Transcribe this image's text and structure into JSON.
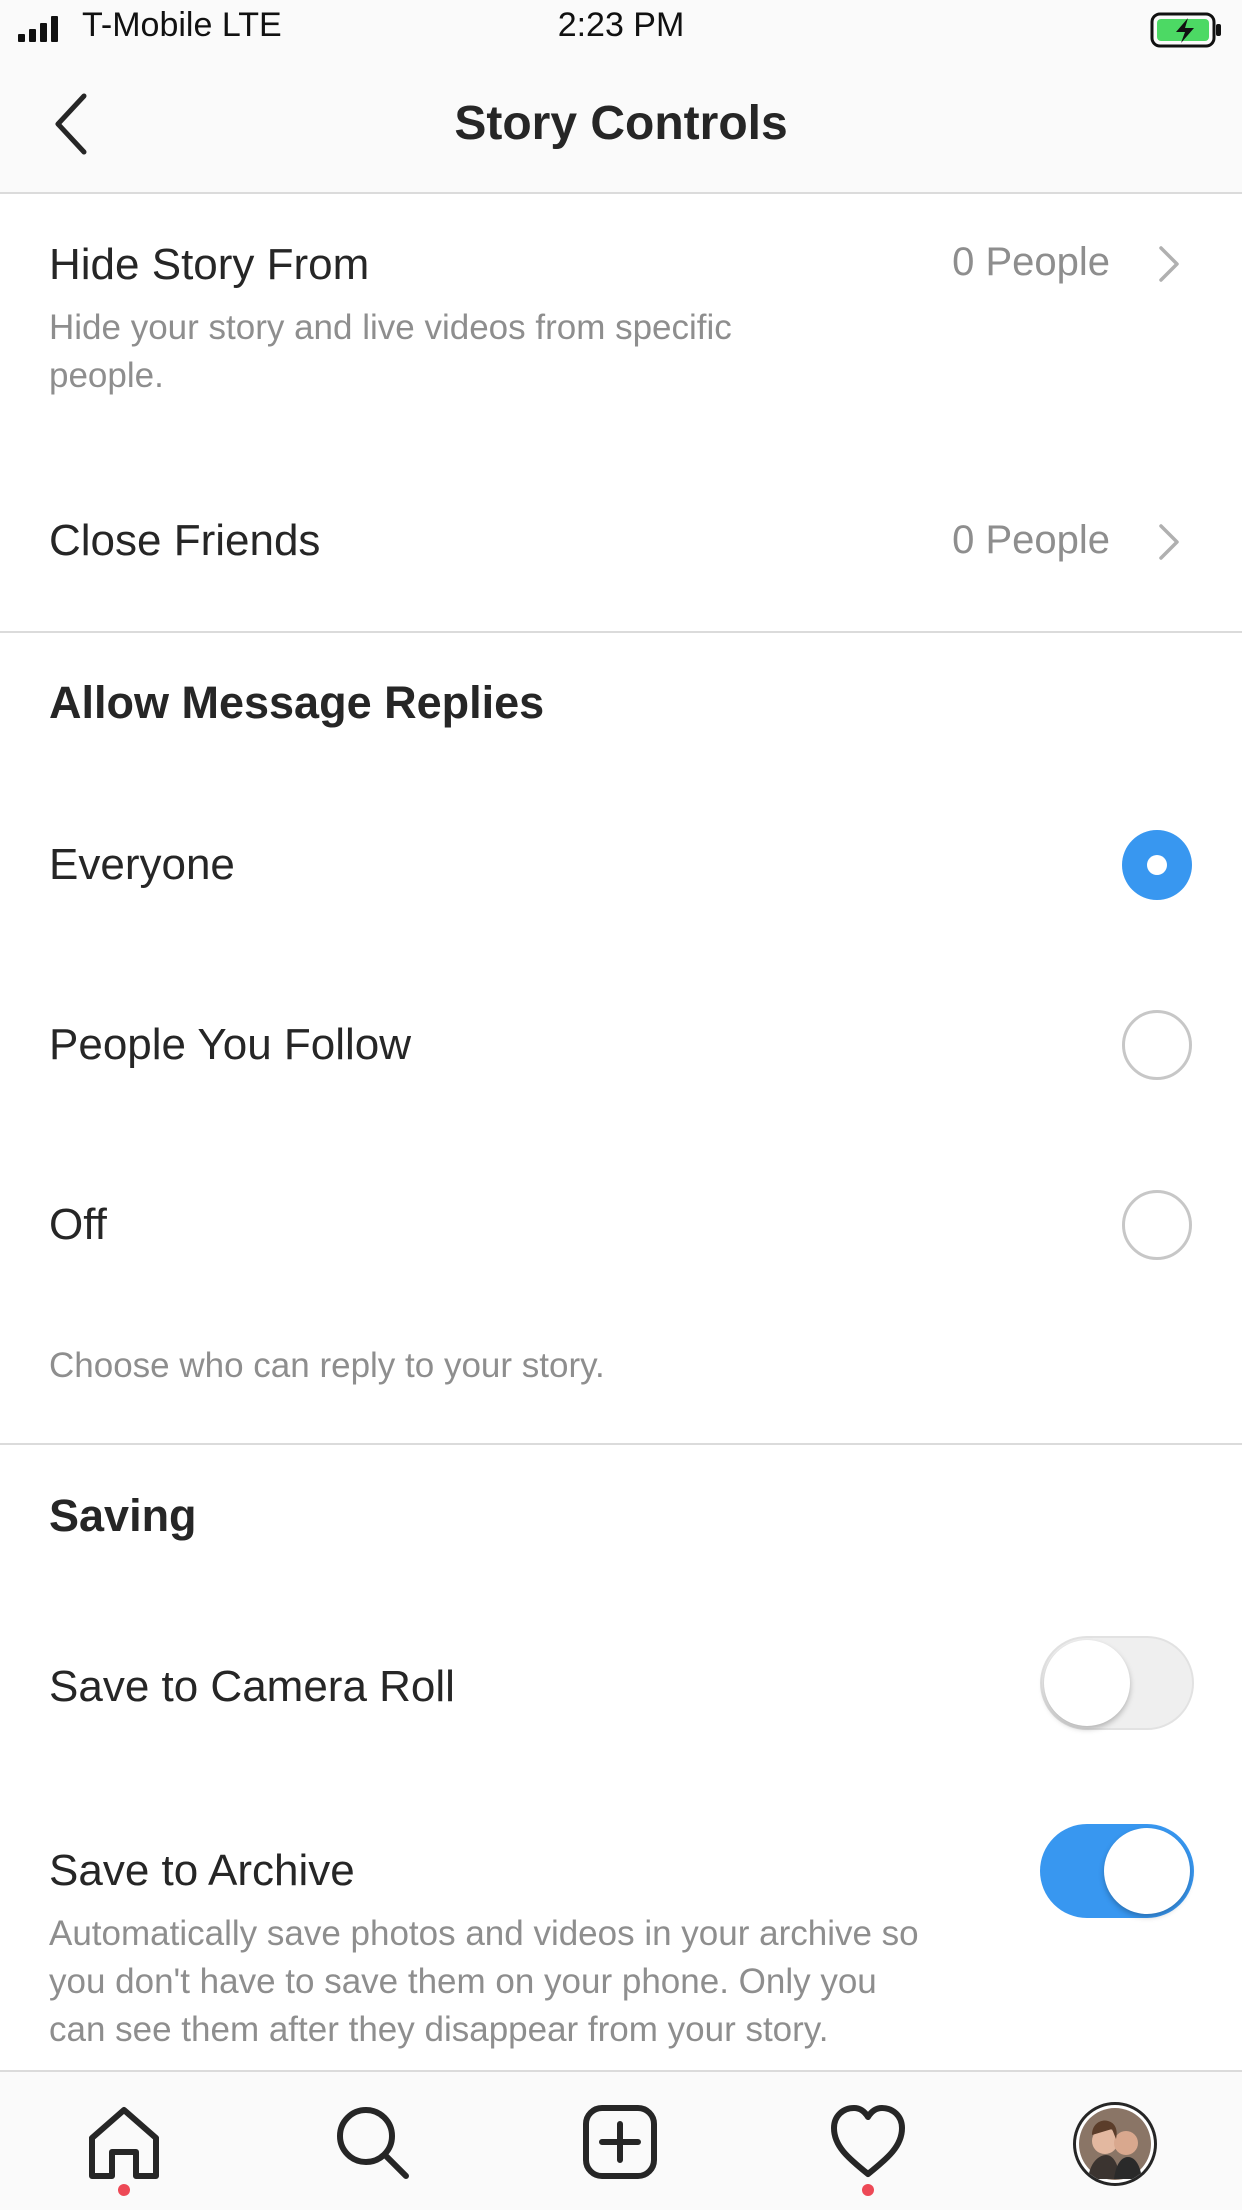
{
  "status_bar": {
    "carrier": "T-Mobile  LTE",
    "time": "2:23 PM",
    "battery_color": "#4cd964"
  },
  "nav": {
    "title": "Story Controls",
    "back_icon": "chevron-left-icon"
  },
  "hide_story": {
    "title": "Hide Story From",
    "subtitle_line1": "Hide your story and live videos from specific",
    "subtitle_line2": "people.",
    "value": "0 People"
  },
  "close_friends": {
    "title": "Close Friends",
    "value": "0 People"
  },
  "replies": {
    "heading": "Allow Message Replies",
    "options": [
      {
        "label": "Everyone",
        "selected": true
      },
      {
        "label": "People You Follow",
        "selected": false
      },
      {
        "label": "Off",
        "selected": false
      }
    ],
    "footer": "Choose who can reply to your story."
  },
  "saving": {
    "heading": "Saving",
    "camera_roll": {
      "label": "Save to Camera Roll",
      "enabled": false
    },
    "archive": {
      "label": "Save to Archive",
      "enabled": true,
      "desc_line1": "Automatically save photos and videos in your archive so",
      "desc_line2": "you don't have to save them on your phone. Only you",
      "desc_line3": "can see them after they disappear from your story."
    }
  },
  "tab_bar": {
    "items": [
      "home-icon",
      "search-icon",
      "new-post-icon",
      "activity-heart-icon",
      "profile-avatar"
    ],
    "notification_dot_color": "#ed4956"
  },
  "colors": {
    "accent": "#3897f0",
    "text": "#262626",
    "secondary": "#8e8e8e",
    "divider": "#dbdbdb",
    "toggle_off": "#efefef"
  }
}
